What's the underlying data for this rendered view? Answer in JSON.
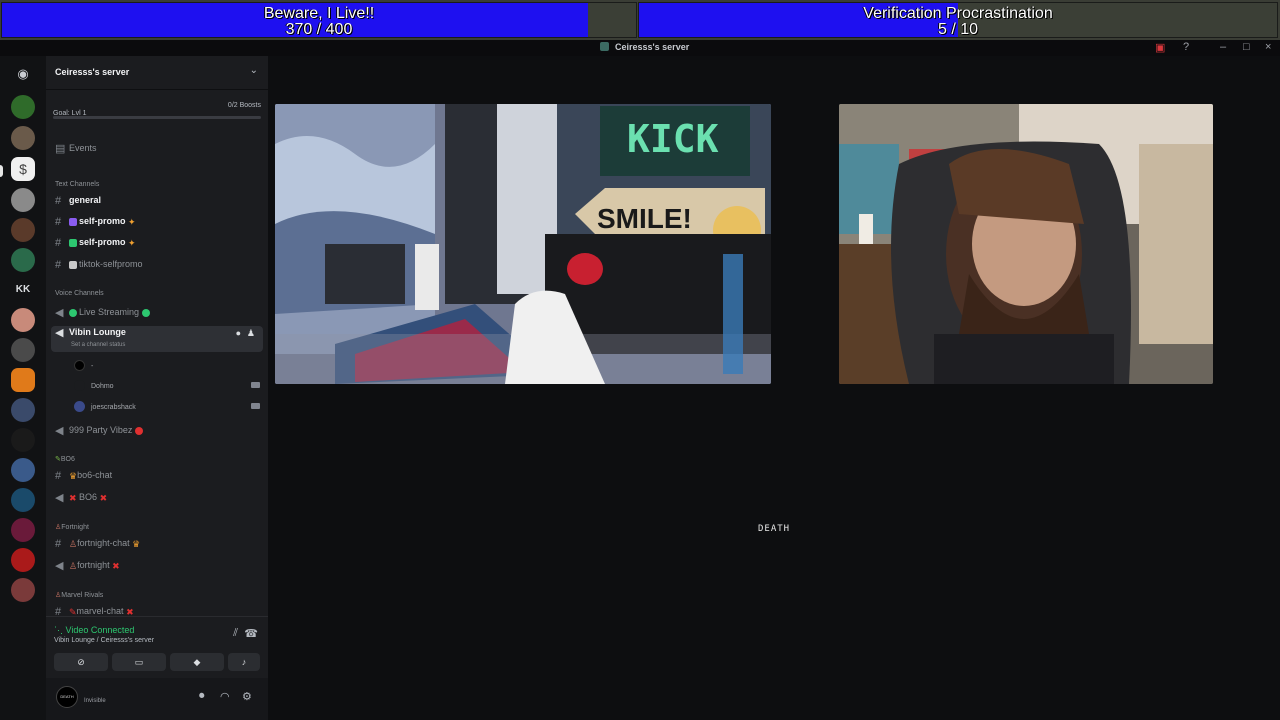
{
  "goals": [
    {
      "title": "Beware, I Live!!",
      "progress": "370 / 400",
      "current": 370,
      "target": 400
    },
    {
      "title": "Verification Procrastination",
      "progress": "5 / 10",
      "current": 5,
      "target": 10
    }
  ],
  "window": {
    "title": "Ceiresss's server",
    "controls": {
      "minimize": "–",
      "maximize": "□",
      "close": "×"
    }
  },
  "sidebar": {
    "server_name": "Ceiresss's server",
    "goal_label": "Goal: Lvl 1",
    "boosts": "0/2 Boosts",
    "events": "Events",
    "categories": {
      "text": "Text Channels",
      "voice": "Voice Channels",
      "bo6": "BO6",
      "fortnight": "Fortnight",
      "marvel": "Marvel Rivals"
    },
    "text_channels": [
      "general",
      "self-promo",
      "self-promo",
      "tiktok-selfpromo"
    ],
    "voice_channels": {
      "live": "Live Streaming",
      "lounge": "Vibin Lounge",
      "lounge_status": "Set a channel status",
      "users": [
        "-",
        "Dohmo",
        "joescrabshack"
      ],
      "party": "999 Party Vibez"
    },
    "bo6_channels": [
      "bo6-chat",
      "BO6"
    ],
    "fortnight_channels": [
      "fortnight-chat",
      "fortnight"
    ],
    "marvel_channels": [
      "marvel-chat"
    ]
  },
  "voice_panel": {
    "status": "Video Connected",
    "location": "Vibin Lounge / Ceiresss's server"
  },
  "user_panel": {
    "avatar_text": "DEATH",
    "status": "Invisible"
  },
  "stage": {
    "label": "DEATH"
  },
  "colors": {
    "goal_fill": "#1e10f0",
    "connected": "#2dc770",
    "sidebar_bg": "#1b1c1f"
  }
}
